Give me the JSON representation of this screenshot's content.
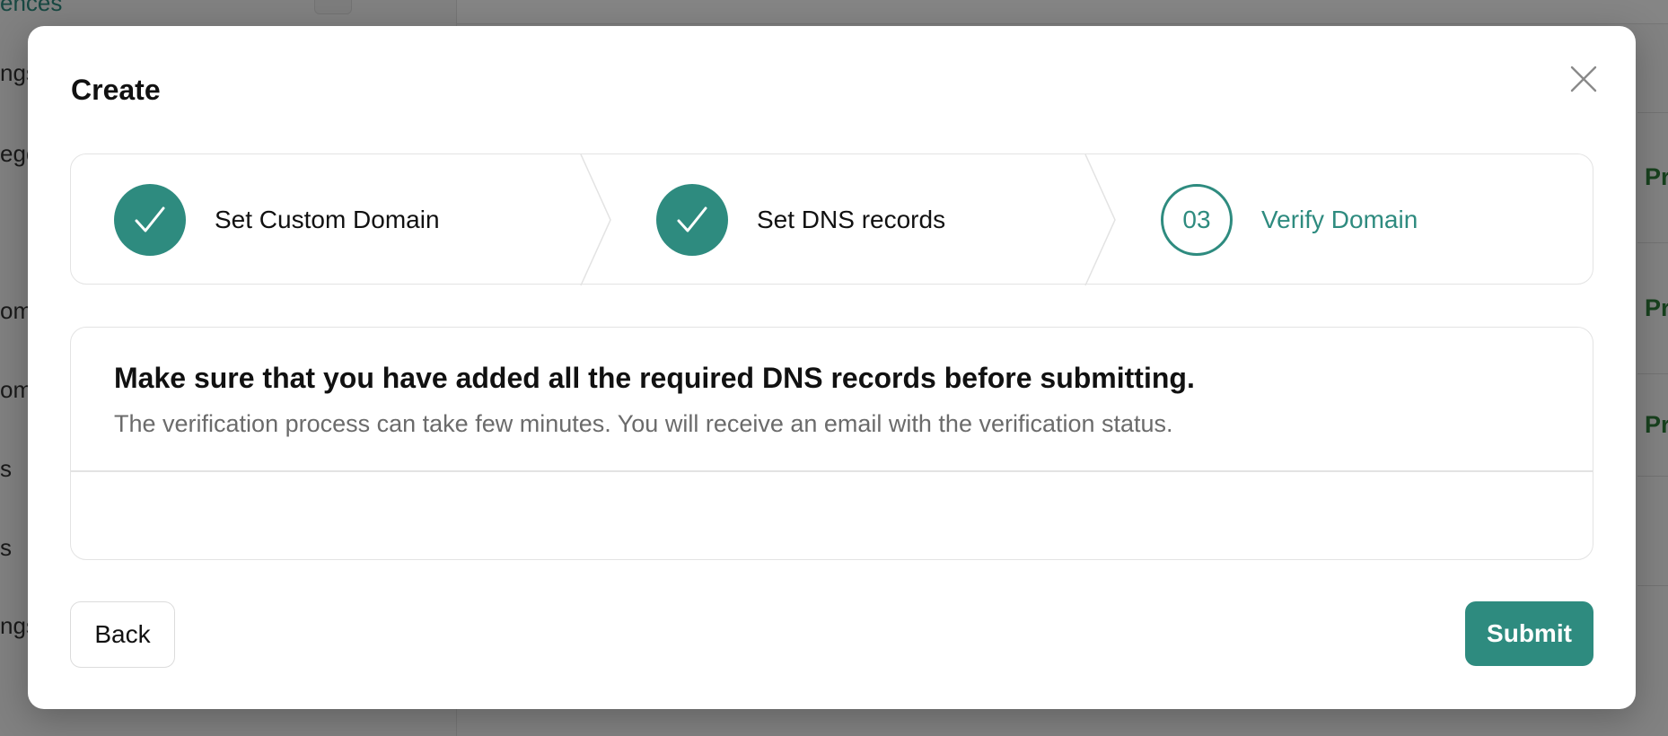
{
  "background": {
    "sidebar_items": [
      "ences",
      "ngs",
      "egor",
      "om",
      "om",
      "s",
      "s",
      "ngs"
    ],
    "right_column_text": [
      "Pr",
      "Pr",
      "Pr"
    ]
  },
  "modal": {
    "title": "Create",
    "close_icon": "close-icon"
  },
  "stepper": {
    "steps": [
      {
        "label": "Set Custom Domain",
        "status": "completed",
        "icon": "check-icon"
      },
      {
        "label": "Set DNS records",
        "status": "completed",
        "icon": "check-icon"
      },
      {
        "label": "Verify Domain",
        "status": "current",
        "number": "03"
      }
    ]
  },
  "content": {
    "heading": "Make sure that you have added all the required DNS records before submitting.",
    "description": "The verification process can take few minutes. You will receive an email with the verification status."
  },
  "footer": {
    "back_label": "Back",
    "submit_label": "Submit"
  },
  "colors": {
    "accent": "#2e8b7f",
    "overlay": "rgba(0,0,0,0.48)"
  }
}
